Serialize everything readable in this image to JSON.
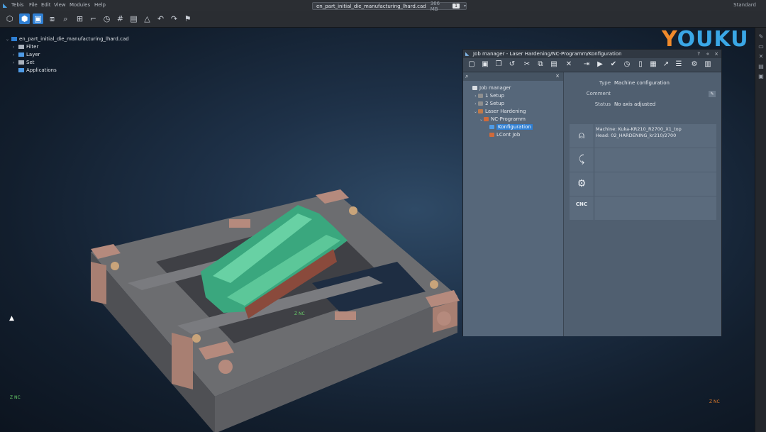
{
  "menubar": {
    "app_name": "Tebis",
    "menus": [
      "File",
      "Edit",
      "View",
      "Modules",
      "Help"
    ],
    "file_tab": {
      "name": "en_part_initial_die_manufacturing_lhard.cad",
      "memory": "366 MB",
      "page": "1"
    },
    "workspace": "Standard"
  },
  "toolbar": {
    "icons": [
      "cube-wire-icon",
      "cube-solid-icon",
      "cube-shaded-icon",
      "frame-icon",
      "zoom-icon",
      "fit-icon",
      "timer-icon",
      "grid-icon",
      "axis-icon",
      "clock-icon",
      "layout-icon",
      "triangle-icon",
      "rotate-left-icon",
      "rotate-right-icon",
      "flag-icon"
    ]
  },
  "tree": {
    "root": "en_part_initial_die_manufacturing_lhard.cad",
    "items": [
      "Filter",
      "Layer",
      "Set",
      "Applications"
    ]
  },
  "watermark": {
    "y": "Y",
    "rest": "OUKU"
  },
  "axis_labels": {
    "left": "Z NC",
    "center": "Z NC",
    "right": "Z NC"
  },
  "job_manager": {
    "title": "Job manager - Laser Hardening/NC-Programm/Konfiguration",
    "title_controls": [
      "?",
      "«",
      "×"
    ],
    "tree": [
      {
        "label": "Job manager",
        "level": 0,
        "twisty": ""
      },
      {
        "label": "1 Setup",
        "level": 1,
        "twisty": "›"
      },
      {
        "label": "2 Setup",
        "level": 1,
        "twisty": "›"
      },
      {
        "label": "Laser Hardening",
        "level": 1,
        "twisty": "⌄"
      },
      {
        "label": "NC-Programm",
        "level": 2,
        "twisty": "⌄"
      },
      {
        "label": "Konfiguration",
        "level": 3,
        "twisty": "",
        "selected": true
      },
      {
        "label": "LCont Job",
        "level": 3,
        "twisty": ""
      }
    ],
    "properties": [
      {
        "key": "Type",
        "value": "Machine configuration"
      },
      {
        "key": "Comment",
        "value": ""
      },
      {
        "key": "Status",
        "value": "No axis adjusted"
      }
    ],
    "cards": [
      {
        "icon": "robot-icon",
        "lines": [
          "Machine: Kuka-KR210_R2700_X1_top",
          "Head: 02_HARDENING_kr210/2700"
        ]
      },
      {
        "icon": "laser-head-icon",
        "lines": []
      },
      {
        "icon": "gears-icon",
        "lines": []
      },
      {
        "icon": "cnc-icon",
        "label": "CNC",
        "lines": []
      }
    ]
  }
}
